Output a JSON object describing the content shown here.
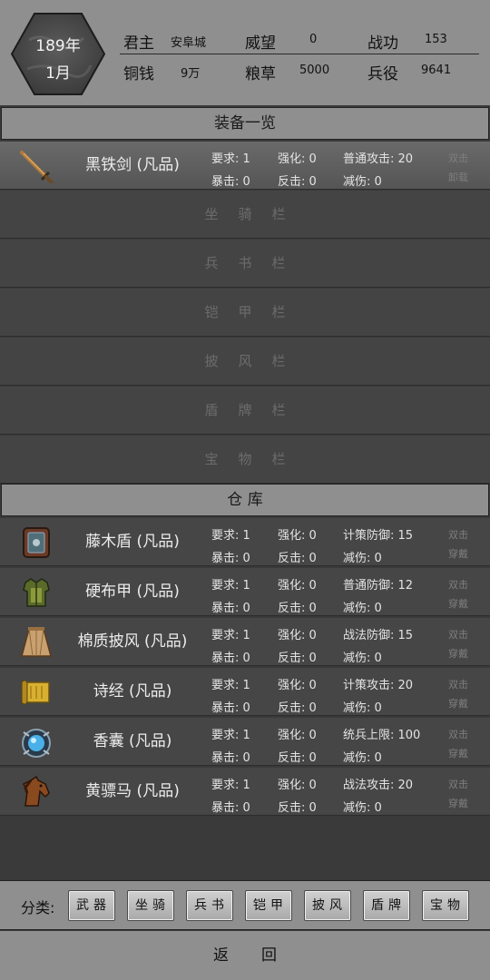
{
  "header": {
    "year": "189年",
    "month": "1月",
    "stats": [
      {
        "label": "君主",
        "value": "安阜城"
      },
      {
        "label": "威望",
        "value": "0"
      },
      {
        "label": "战功",
        "value": "153"
      },
      {
        "label": "铜钱",
        "value": "9万"
      },
      {
        "label": "粮草",
        "value": "5000"
      },
      {
        "label": "兵役",
        "value": "9641"
      }
    ]
  },
  "equipment": {
    "title": "装备一览",
    "equipped": [
      {
        "icon": "sword-icon",
        "name": "黑铁剑 (凡品)",
        "req": "要求: 1",
        "enh": "强化: 0",
        "attr": "普通攻击: 20",
        "crit": "暴击: 0",
        "counter": "反击: 0",
        "reduce": "减伤: 0",
        "action1": "双击",
        "action2": "卸载"
      }
    ],
    "empty_slots": [
      "坐骑栏",
      "兵书栏",
      "铠甲栏",
      "披风栏",
      "盾牌栏",
      "宝物栏"
    ]
  },
  "storage": {
    "title": "仓 库",
    "items": [
      {
        "icon": "shield-icon",
        "name": "藤木盾 (凡品)",
        "req": "要求: 1",
        "enh": "强化: 0",
        "attr": "计策防御: 15",
        "crit": "暴击: 0",
        "counter": "反击: 0",
        "reduce": "减伤: 0",
        "action1": "双击",
        "action2": "穿戴"
      },
      {
        "icon": "armor-icon",
        "name": "硬布甲 (凡品)",
        "req": "要求: 1",
        "enh": "强化: 0",
        "attr": "普通防御: 12",
        "crit": "暴击: 0",
        "counter": "反击: 0",
        "reduce": "减伤: 0",
        "action1": "双击",
        "action2": "穿戴"
      },
      {
        "icon": "cloak-icon",
        "name": "棉质披风 (凡品)",
        "req": "要求: 1",
        "enh": "强化: 0",
        "attr": "战法防御: 15",
        "crit": "暴击: 0",
        "counter": "反击: 0",
        "reduce": "减伤: 0",
        "action1": "双击",
        "action2": "穿戴"
      },
      {
        "icon": "scroll-icon",
        "name": "诗经 (凡品)",
        "req": "要求: 1",
        "enh": "强化: 0",
        "attr": "计策攻击: 20",
        "crit": "暴击: 0",
        "counter": "反击: 0",
        "reduce": "减伤: 0",
        "action1": "双击",
        "action2": "穿戴"
      },
      {
        "icon": "sachet-icon",
        "name": "香囊 (凡品)",
        "req": "要求: 1",
        "enh": "强化: 0",
        "attr": "统兵上限: 100",
        "crit": "暴击: 0",
        "counter": "反击: 0",
        "reduce": "减伤: 0",
        "action1": "双击",
        "action2": "穿戴"
      },
      {
        "icon": "horse-icon",
        "name": "黄骠马 (凡品)",
        "req": "要求: 1",
        "enh": "强化: 0",
        "attr": "战法攻击: 20",
        "crit": "暴击: 0",
        "counter": "反击: 0",
        "reduce": "减伤: 0",
        "action1": "双击",
        "action2": "穿戴"
      }
    ]
  },
  "filter": {
    "label": "分类:",
    "buttons": [
      "武器",
      "坐骑",
      "兵书",
      "铠甲",
      "披风",
      "盾牌",
      "宝物"
    ]
  },
  "back_label": "返回"
}
